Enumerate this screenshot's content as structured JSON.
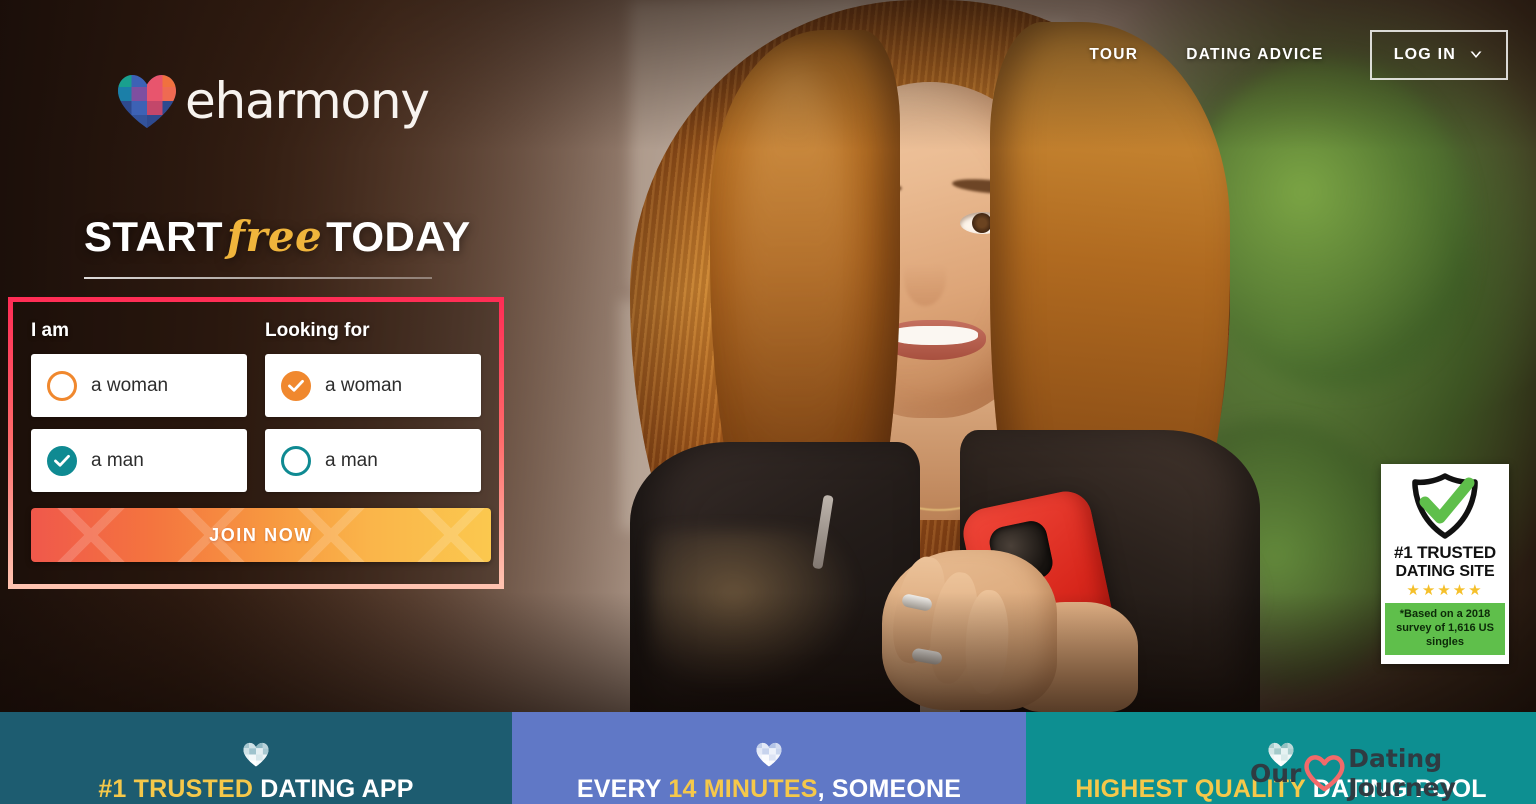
{
  "brand": {
    "name": "eharmony",
    "logo_icon": "checkered-heart-icon",
    "logo_colors": [
      "#19a08e",
      "#3d62b5",
      "#e8556d",
      "#f0713f",
      "#2e4a8f"
    ]
  },
  "nav": {
    "links": [
      {
        "label": "TOUR",
        "name": "nav-tour"
      },
      {
        "label": "DATING ADVICE",
        "name": "nav-dating-advice"
      }
    ],
    "login": {
      "label": "LOG IN",
      "icon": "chevron-down-icon"
    }
  },
  "hero": {
    "headline_pre": "START",
    "headline_accent": "free",
    "headline_post": "TODAY",
    "accent_color": "#f0b53c"
  },
  "form": {
    "highlighted": true,
    "highlight_color": "#ff2d55",
    "columns": [
      {
        "label": "I am",
        "name": "i-am",
        "options": [
          {
            "label": "a woman",
            "selected": false,
            "color": "#f0882e"
          },
          {
            "label": "a man",
            "selected": true,
            "color": "#0f8a92"
          }
        ]
      },
      {
        "label": "Looking for",
        "name": "looking-for",
        "options": [
          {
            "label": "a woman",
            "selected": true,
            "color": "#f0882e"
          },
          {
            "label": "a man",
            "selected": false,
            "color": "#0f8a92"
          }
        ]
      }
    ],
    "submit_label": "JOIN NOW"
  },
  "badge": {
    "icon": "shield-check-icon",
    "line1": "#1 TRUSTED",
    "line2": "DATING SITE",
    "stars": "★★★★★",
    "star_count": 5,
    "footnote": "*Based on a 2018 survey of 1,616 US singles"
  },
  "panels": [
    {
      "name": "panel-trusted-app",
      "icon": "checkered-heart-icon",
      "highlight": "#1 TRUSTED",
      "rest": " DATING APP",
      "bg": "#1d5c70"
    },
    {
      "name": "panel-every-14-minutes",
      "icon": "checkered-heart-icon",
      "pre": "EVERY ",
      "highlight": "14 MINUTES",
      "rest": ", SOMEONE",
      "bg": "#6078c6"
    },
    {
      "name": "panel-highest-quality",
      "icon": "checkered-heart-icon",
      "highlight": "HIGHEST QUALITY",
      "rest": " DATING POOL",
      "bg": "#0d8f91"
    }
  ],
  "watermark": {
    "pre": "Our",
    "icon": "heart-outline-icon",
    "post": "Dating Journey",
    "color": "#2f3b42",
    "heart_color": "#f26a6a"
  }
}
